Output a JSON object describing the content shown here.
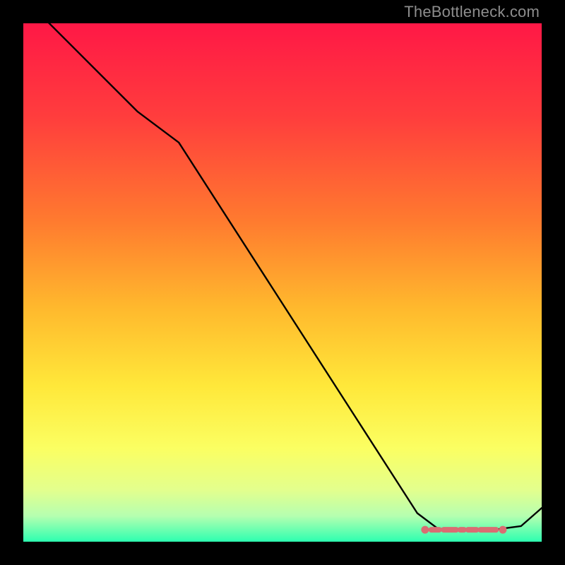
{
  "watermark": "TheBottleneck.com",
  "chart_data": {
    "type": "line",
    "title": "",
    "xlabel": "",
    "ylabel": "",
    "xlim": [
      0,
      100
    ],
    "ylim": [
      0,
      100
    ],
    "gradient_stops": [
      {
        "offset": 0,
        "color": "#ff1846"
      },
      {
        "offset": 18,
        "color": "#ff3d3d"
      },
      {
        "offset": 38,
        "color": "#ff7a2f"
      },
      {
        "offset": 55,
        "color": "#ffb92d"
      },
      {
        "offset": 70,
        "color": "#ffe83a"
      },
      {
        "offset": 82,
        "color": "#fbff62"
      },
      {
        "offset": 90,
        "color": "#e3ff8d"
      },
      {
        "offset": 95,
        "color": "#b6ffb0"
      },
      {
        "offset": 100,
        "color": "#2dffb0"
      }
    ],
    "series": [
      {
        "name": "bottleneck-curve",
        "color": "#000000",
        "x": [
          0,
          10,
          22,
          30,
          76,
          80,
          90,
          96,
          100
        ],
        "y": [
          105,
          95,
          83,
          77,
          5.5,
          2.5,
          2.2,
          3,
          6.5
        ]
      }
    ],
    "highlight": {
      "color": "#d96d72",
      "radius_ends": 5.5,
      "stroke_width": 8,
      "points_x": [
        77.5,
        92.5
      ],
      "points_y": [
        2.3,
        2.3
      ],
      "dash_segments_x": [
        [
          78.7,
          80.2
        ],
        [
          81.1,
          83.5
        ],
        [
          84.3,
          85.0
        ],
        [
          85.8,
          87.4
        ],
        [
          88.2,
          91.2
        ]
      ]
    }
  }
}
